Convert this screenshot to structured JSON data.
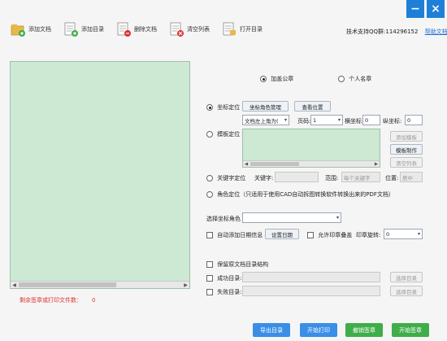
{
  "window": {
    "minimize_label": "−",
    "close_label": "×"
  },
  "toolbar": {
    "add_doc": "添加文档",
    "add_dir": "添加目录",
    "delete_doc": "删除文档",
    "clear_list": "清空列表",
    "open_dir": "打开目录"
  },
  "support": {
    "text": "技术支持QQ群:114296152",
    "help": "帮助文档"
  },
  "preview": {
    "remaining_label": "剩余签章或打印文件数：",
    "remaining_count": "0"
  },
  "mode": {
    "public_seal": "加盖公章",
    "personal_name": "个人名章"
  },
  "full_pos": {
    "label": "坐标定位",
    "manage_btn": "坐标角色管理",
    "view_btn": "查看位置",
    "anchor_value": "文档左上角为(",
    "page_label": "页码:",
    "page_value": "1",
    "x_label": "横坐标:",
    "x_value": "0",
    "y_label": "纵坐标:",
    "y_value": "0"
  },
  "template_pos": {
    "label": "模板定位",
    "add_tpl": "添加模板",
    "make_tpl": "模板制作",
    "clear_list": "清空列表"
  },
  "keyword_pos": {
    "label": "关键字定位",
    "keyword_label": "关键字:",
    "range_label": "范围:",
    "range_value": "每个关键字",
    "position_label": "位置:",
    "position_value": "居中"
  },
  "role_pos": {
    "label": "角色定位（只适用于使用CAD自动拆图转换软件转换出来的PDF文档）"
  },
  "role_select": {
    "label": "选择坐标角色",
    "value": ""
  },
  "auto_date": {
    "label": "自动添加日期信息",
    "set_btn": "设置日期",
    "overlap_label": "允许印章叠盖",
    "rotate_label": "印章旋转:",
    "rotate_value": "0"
  },
  "keep_dir": {
    "label": "保留原文档目录结构"
  },
  "success_dir": {
    "label": "成功目录:",
    "btn": "选择目录"
  },
  "fail_dir": {
    "label": "失败目录:",
    "btn": "选择目录"
  },
  "bottom": {
    "export_dir": "导出目录",
    "start_print": "开始打印",
    "undo_seal": "撤销签章",
    "start_seal": "开始签章"
  },
  "colors": {
    "accent": "#1e7fd8",
    "green_btn": "#3fae4a",
    "preview_bg": "#cde9d3",
    "warn": "#e03030"
  }
}
